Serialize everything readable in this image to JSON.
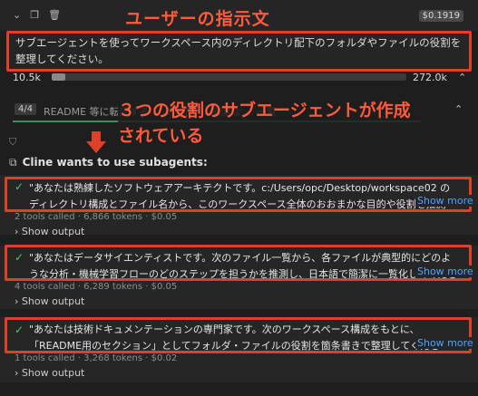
{
  "header": {
    "cost": "$0.1919",
    "annotation_title": "ユーザーの指示文"
  },
  "instruction": {
    "text": "サブエージェントを使ってワークスペース内のディレクトリ配下のフォルダやファイルの役割を整理してください。"
  },
  "tokens": {
    "left": "10.5k",
    "right": "272.0k",
    "progress": 0.039
  },
  "task": {
    "badge": "4/4",
    "text": "README 等に転記する ... の役割 ... 簡潔な ... 一覧"
  },
  "annotation_2": {
    "line1": "３つの役割のサブエージェントが作成",
    "line2": "されている"
  },
  "cline": {
    "label": "Cline wants to use subagents:"
  },
  "subagents": [
    {
      "text": "\"あなたは熟練したソフトウェアアーキテクトです。c:/Users/opc/Desktop/workspace02 のディレクトリ構成とファイル名から、このワークスペース全体のおおまかな目的や役割を推測し、日本語で整",
      "show_more": "Show more",
      "meta": "2 tools called · 6,866 tokens · $0.05",
      "show_output": "Show output"
    },
    {
      "text": "\"あなたはデータサイエンティストです。次のファイル一覧から、各ファイルが典型的にどのような分析・機械学習フローのどのステップを担うかを推測し、日本語で簡潔に一覧化してください。",
      "show_more": "Show more",
      "meta": "4 tools called · 6,289 tokens · $0.05",
      "show_output": "Show output"
    },
    {
      "text": "\"あなたは技術ドキュメンテーションの専門家です。次のワークスペース構成をもとに、「README用のセクション」としてフォルダ・ファイルの役割を箇条書きで整理してください。まだ中身は読めない",
      "show_more": "Show more",
      "meta": "1 tools called · 3,268 tokens · $0.02",
      "show_output": "Show output"
    }
  ]
}
